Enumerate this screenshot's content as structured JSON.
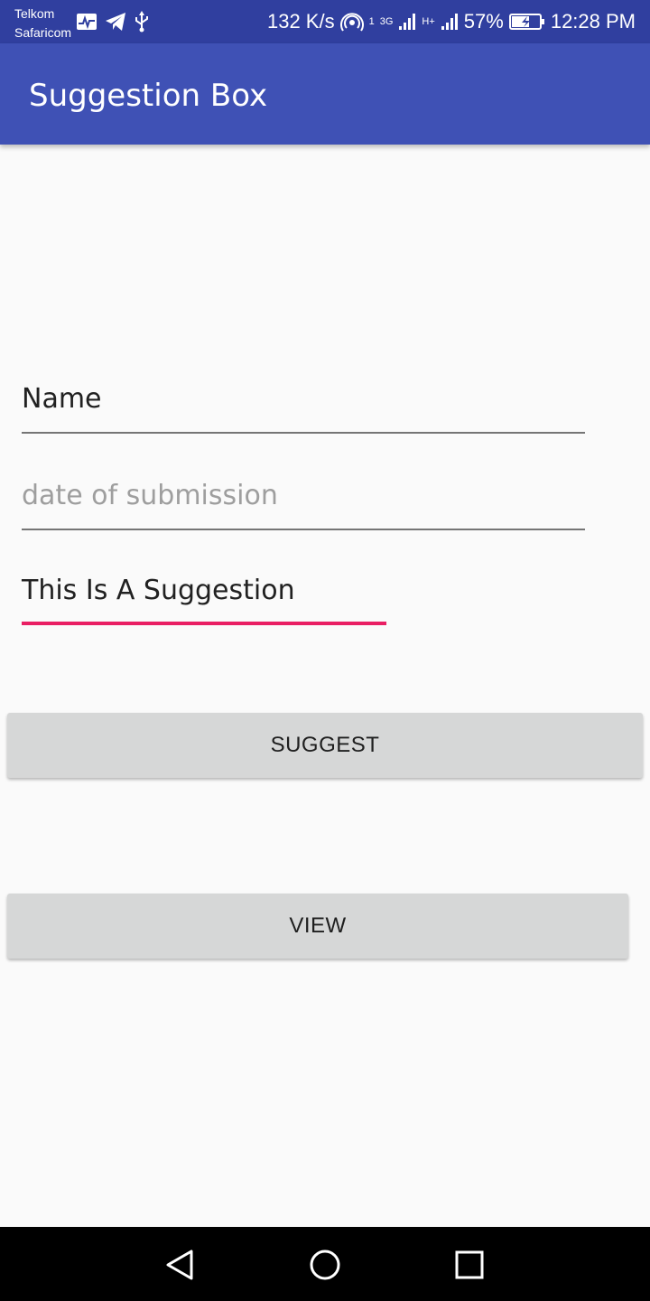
{
  "status_bar": {
    "carriers": [
      "Telkom",
      "Safaricom"
    ],
    "net_speed": "132 K/s",
    "sim1_label": "1",
    "network_3g": "3G",
    "network_hplus": "H+",
    "battery": "57%",
    "time": "12:28 PM",
    "icons": [
      "activity-icon",
      "telegram-icon",
      "usb-icon",
      "hotspot-icon",
      "signal-icon",
      "signal-icon",
      "battery-charging-icon"
    ]
  },
  "app_bar": {
    "title": "Suggestion Box"
  },
  "form": {
    "name_value": "Name",
    "date_placeholder": "date of submission",
    "suggestion_value": "This Is A Suggestion"
  },
  "buttons": {
    "suggest_label": "SUGGEST",
    "view_label": "VIEW"
  },
  "nav_bar": {
    "icons": [
      "back-icon",
      "home-icon",
      "recents-icon"
    ]
  },
  "colors": {
    "status_bar": "#303f9f",
    "app_bar": "#3f51b5",
    "accent": "#e91e63",
    "button": "#d6d7d7",
    "background": "#fafafa"
  }
}
